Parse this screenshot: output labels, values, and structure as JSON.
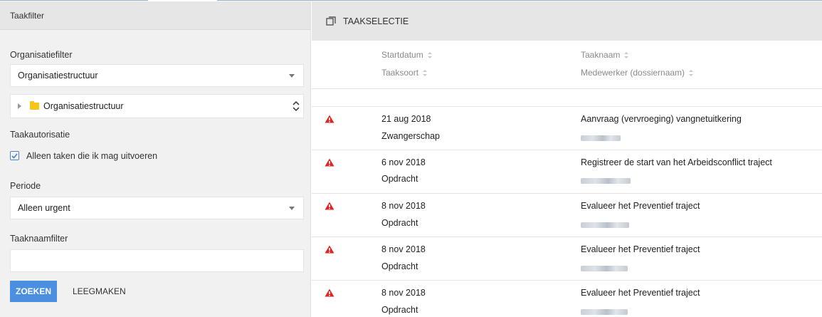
{
  "left_panel": {
    "header": "Taakfilter",
    "org_filter": {
      "label": "Organisatiefilter",
      "selected": "Organisatiestructuur"
    },
    "tree": {
      "root": "Organisatiestructuur"
    },
    "authorization": {
      "label": "Taakautorisatie",
      "checkbox_label": "Alleen taken die ik mag uitvoeren",
      "checked": true
    },
    "period": {
      "label": "Periode",
      "selected": "Alleen urgent"
    },
    "name_filter": {
      "label": "Taaknaamfilter",
      "value": ""
    },
    "buttons": {
      "search": "ZOEKEN",
      "clear": "LEEGMAKEN"
    }
  },
  "right_panel": {
    "header": "TAAKSELECTIE",
    "columns": {
      "start_date": "Startdatum",
      "task_name": "Taaknaam",
      "task_type": "Taaksoort",
      "employee": "Medewerker (dossiernaam)"
    },
    "rows": [
      {
        "start_date": "21 aug 2018",
        "task_type": "Zwangerschap",
        "task_name": "Aanvraag (vervroeging) vangnetuitkering",
        "icon": "warning-icon"
      },
      {
        "start_date": "6 nov 2018",
        "task_type": "Opdracht",
        "task_name": "Registreer de start van het Arbeidsconflict traject",
        "icon": "warning-icon"
      },
      {
        "start_date": "8 nov 2018",
        "task_type": "Opdracht",
        "task_name": "Evalueer het Preventief traject",
        "icon": "warning-icon"
      },
      {
        "start_date": "8 nov 2018",
        "task_type": "Opdracht",
        "task_name": "Evalueer het Preventief traject",
        "icon": "warning-icon"
      },
      {
        "start_date": "8 nov 2018",
        "task_type": "Opdracht",
        "task_name": "Evalueer het Preventief traject",
        "icon": "warning-icon"
      }
    ]
  },
  "colors": {
    "accent": "#4a8fe0",
    "warning": "#e02424",
    "folder": "#f5c518"
  }
}
